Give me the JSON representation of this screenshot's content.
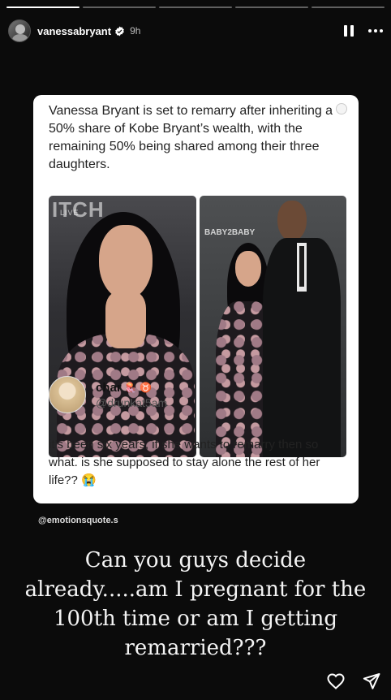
{
  "story": {
    "segments": [
      1.0,
      0.0,
      0.0,
      0.0,
      0.0
    ],
    "username": "vanessabryant",
    "time": "9h"
  },
  "post": {
    "headline": "Vanessa Bryant is set to remarry after inheriting a 50% share of Kobe Bryant’s wealth, with the remaining 50% being shared among their three daughters.",
    "photo_left_logo": "ITCH",
    "photo_left_sub": "LIVE",
    "photo_right_banner": "BABY2BABY",
    "author_name": "char",
    "author_emoji": "🪼 ♉",
    "author_handle": "@drunkat5am",
    "reply": "it’s been six years, if she wants to remarry then so what. is she supposed to stay alone the rest of her life?? 😭"
  },
  "source": "@emotionsquote.s",
  "caption": "Can you guys decide already.....am I pregnant for the 100th time or am I getting remarried???",
  "icons": {
    "verified": "verified-badge-icon",
    "pause": "pause-icon",
    "more": "more-icon",
    "like": "heart-icon",
    "share": "send-icon"
  }
}
